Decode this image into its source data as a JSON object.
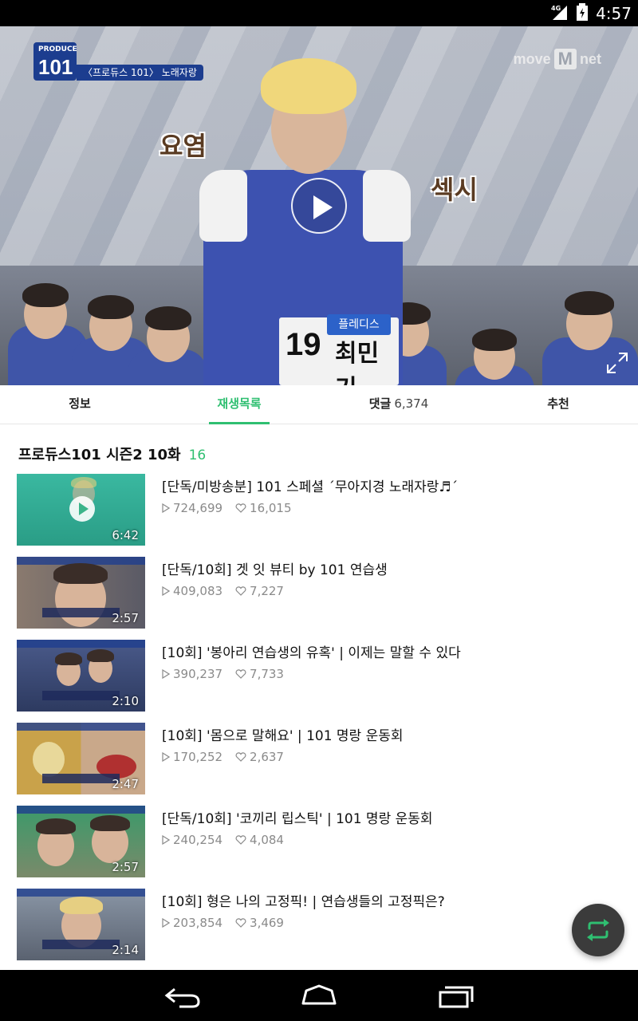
{
  "status_bar": {
    "network": "4G",
    "time": "4:57"
  },
  "player": {
    "channel_caption": "〈프로듀스 101〉 노래자랑",
    "show_logo_top": "PRODUCE",
    "show_logo_big": "101",
    "broadcaster_prefix": "move",
    "broadcaster_m": "M",
    "broadcaster_suffix": "net",
    "sticker_left": "요염",
    "sticker_right": "섹시",
    "bib_number": "19",
    "bib_name": "최민기",
    "bib_tag": "플레디스"
  },
  "tabs": [
    {
      "label": "정보",
      "count": "",
      "active": false
    },
    {
      "label": "재생목록",
      "count": "",
      "active": true
    },
    {
      "label": "댓글",
      "count": "6,374",
      "active": false
    },
    {
      "label": "추천",
      "count": "",
      "active": false
    }
  ],
  "playlist": {
    "title": "프로듀스101 시즌2 10화",
    "count": "16",
    "items": [
      {
        "title": "[단독/미방송분] 101 스페셜 ´무아지경 노래자랑♬´",
        "views": "724,699",
        "likes": "16,015",
        "duration": "6:42"
      },
      {
        "title": "[단독/10회] 겟 잇 뷰티 by 101 연습생",
        "views": "409,083",
        "likes": "7,227",
        "duration": "2:57"
      },
      {
        "title": "[10회] '봉아리 연습생의 유혹' | 이제는 말할 수 있다",
        "views": "390,237",
        "likes": "7,733",
        "duration": "2:10"
      },
      {
        "title": "[10회] '몸으로 말해요' | 101 명랑 운동회",
        "views": "170,252",
        "likes": "2,637",
        "duration": "2:47"
      },
      {
        "title": "[단독/10회] '코끼리 립스틱' | 101 명랑 운동회",
        "views": "240,254",
        "likes": "4,084",
        "duration": "2:57"
      },
      {
        "title": "[10회] 형은 나의 고정픽! | 연습생들의 고정픽은?",
        "views": "203,854",
        "likes": "3,469",
        "duration": "2:14"
      }
    ]
  },
  "icons": {
    "play": "play-icon",
    "fullscreen": "expand-icon",
    "repeat": "repeat-icon",
    "views": "play-triangle-icon",
    "likes": "heart-icon"
  },
  "colors": {
    "accent": "#2fbf71",
    "fab_bg": "#3b3b3b"
  }
}
